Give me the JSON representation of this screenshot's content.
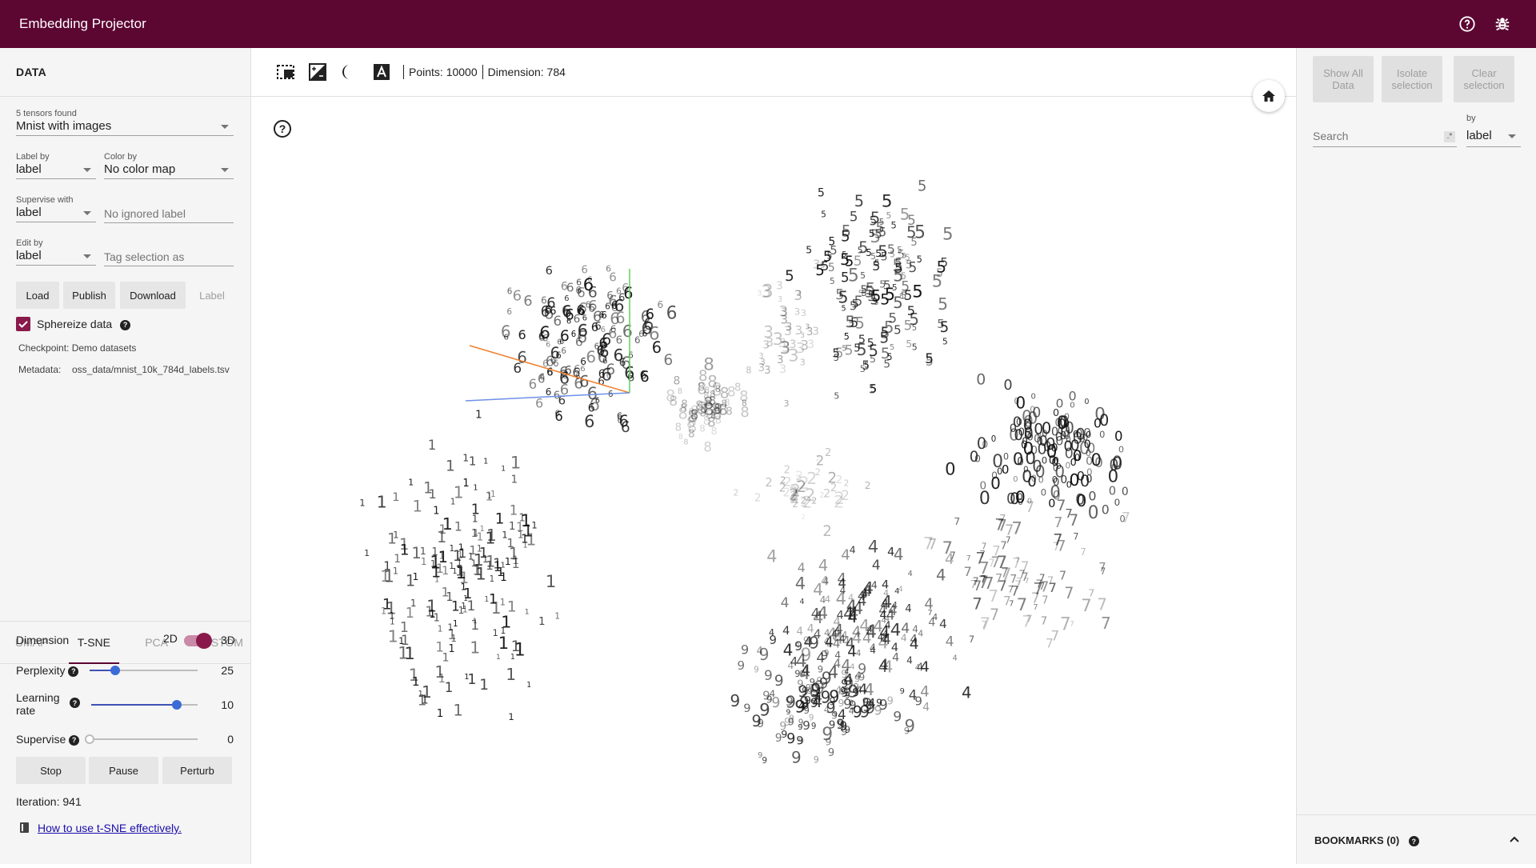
{
  "header": {
    "title": "Embedding Projector",
    "help_icon": "help-circle-icon",
    "bug_icon": "bug-icon"
  },
  "data_panel": {
    "title": "DATA",
    "tensors": {
      "label": "5 tensors found",
      "value": "Mnist with images"
    },
    "label_by": {
      "label": "Label by",
      "value": "label"
    },
    "color_by": {
      "label": "Color by",
      "value": "No color map"
    },
    "supervise_with": {
      "label": "Supervise with",
      "value": "label"
    },
    "ignored_label": {
      "placeholder": "No ignored label"
    },
    "edit_by": {
      "label": "Edit by",
      "value": "label"
    },
    "tag_selection": {
      "placeholder": "Tag selection as"
    },
    "buttons": {
      "load": "Load",
      "publish": "Publish",
      "download": "Download",
      "label": "Label"
    },
    "sphereize": {
      "label": "Sphereize data",
      "checked": true
    },
    "checkpoint": "Checkpoint: Demo datasets",
    "metadata_label": "Metadata:",
    "metadata_value": "oss_data/mnist_10k_784d_labels.tsv"
  },
  "projection": {
    "tabs": [
      "UMAP",
      "T-SNE",
      "PCA",
      "CUSTOM"
    ],
    "active_tab": "T-SNE",
    "dimension": {
      "label": "Dimension",
      "option_2d": "2D",
      "option_3d": "3D",
      "selected": "3D"
    },
    "perplexity": {
      "label": "Perplexity",
      "value": "25",
      "fraction": 0.25
    },
    "learning_rate": {
      "label": "Learning rate",
      "value": "10",
      "fraction": 0.8
    },
    "supervise": {
      "label": "Supervise",
      "value": "0",
      "fraction": 0
    },
    "buttons": {
      "stop": "Stop",
      "pause": "Pause",
      "perturb": "Perturb"
    },
    "iteration": "Iteration: 941",
    "link": "How to use t-SNE effectively."
  },
  "toolbar": {
    "points": "Points: 10000",
    "dimension": "Dimension: 784",
    "icons": [
      "select-rect-icon",
      "night-mode-icon",
      "contrast-icon",
      "label-toggle-icon"
    ]
  },
  "inspector": {
    "show_all": "Show All Data",
    "isolate": "Isolate selection",
    "clear": "Clear selection",
    "search_placeholder": "Search",
    "regex": ".*",
    "by_label": "by",
    "by_value": "label",
    "bookmarks": "BOOKMARKS (0)"
  },
  "colors": {
    "header": "#5c0632",
    "accent": "#8a1a4b",
    "slider": "#3b6bd6"
  }
}
